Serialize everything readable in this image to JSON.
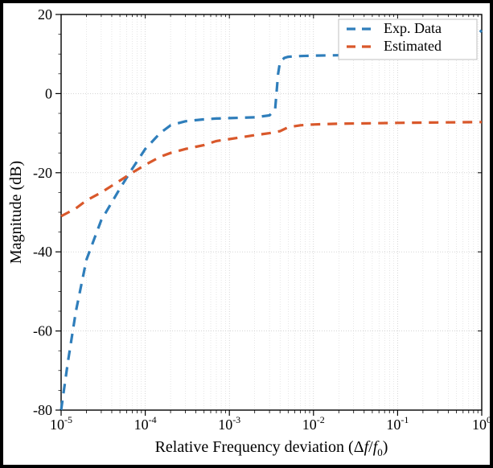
{
  "chart_data": {
    "type": "line",
    "xlabel": "Relative Frequency deviation (\\Delta f/f_0)",
    "ylabel": "Magnitude (dB)",
    "xscale": "log",
    "xlim": [
      1e-05,
      1
    ],
    "ylim": [
      -80,
      20
    ],
    "ytick_values": [
      -80,
      -60,
      -40,
      -20,
      0,
      20
    ],
    "ytick_labels": [
      "-80",
      "-60",
      "-40",
      "-20",
      "0",
      "20"
    ],
    "xtick_values": [
      1e-05,
      0.0001,
      0.001,
      0.01,
      0.1,
      1
    ],
    "xtick_labels": [
      "10^{-5}",
      "10^{-4}",
      "10^{-3}",
      "10^{-2}",
      "10^{-1}",
      "10^{0}"
    ],
    "series": [
      {
        "name": "Exp. Data",
        "color": "#2f7ebb",
        "style": "dashed",
        "x": [
          1e-05,
          1.2e-05,
          1.5e-05,
          2e-05,
          3e-05,
          5e-05,
          7e-05,
          0.0001,
          0.00015,
          0.0002,
          0.0003,
          0.0005,
          0.0007,
          0.001,
          0.002,
          0.003,
          0.0035,
          0.0038,
          0.004,
          0.0045,
          0.005,
          0.007,
          0.01,
          0.02,
          0.05,
          0.1,
          0.2,
          0.5,
          0.8,
          1
        ],
        "y": [
          -80,
          -68,
          -55,
          -42,
          -32,
          -24,
          -19,
          -14,
          -10,
          -8,
          -7,
          -6.5,
          -6.3,
          -6.2,
          -6,
          -5.5,
          -4,
          5,
          8,
          9,
          9.3,
          9.5,
          9.6,
          9.7,
          9.8,
          10,
          10.5,
          12,
          14,
          16
        ]
      },
      {
        "name": "Estimated",
        "color": "#d9582b",
        "style": "dashed",
        "x": [
          1e-05,
          1.5e-05,
          2e-05,
          3e-05,
          5e-05,
          7e-05,
          0.0001,
          0.00015,
          0.0002,
          0.0003,
          0.0005,
          0.0007,
          0.001,
          0.002,
          0.003,
          0.004,
          0.005,
          0.007,
          0.01,
          0.02,
          0.05,
          0.1,
          0.3,
          1
        ],
        "y": [
          -31,
          -29,
          -27,
          -25,
          -22,
          -20,
          -18,
          -16,
          -15,
          -14,
          -13,
          -12,
          -11.5,
          -10.5,
          -10,
          -9.5,
          -8.5,
          -8,
          -7.8,
          -7.6,
          -7.5,
          -7.4,
          -7.3,
          -7.2
        ]
      }
    ],
    "legend_position": "upper-right",
    "grid": {
      "minor": true
    }
  }
}
